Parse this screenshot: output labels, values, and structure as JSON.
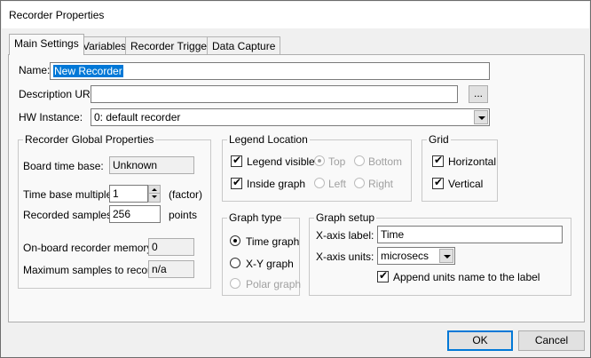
{
  "window": {
    "title": "Recorder Properties"
  },
  "tabs": [
    "Main Settings",
    "Variables",
    "Recorder Trigger",
    "Data Capture"
  ],
  "fields": {
    "name_label": "Name:",
    "name_value": "New Recorder",
    "desc_label": "Description URL:",
    "desc_value": "",
    "browse_label": "...",
    "hw_label": "HW Instance:",
    "hw_value": "0: default recorder"
  },
  "global_props": {
    "title": "Recorder Global Properties",
    "board_time_base_label": "Board time base:",
    "board_time_base_value": "Unknown",
    "time_base_multiple_label": "Time base multiple:",
    "time_base_multiple_value": "1",
    "factor_label": "(factor)",
    "recorded_samples_label": "Recorded samples:",
    "recorded_samples_value": "256",
    "points_label": "points",
    "onboard_memory_label": "On-board recorder memory:",
    "onboard_memory_value": "0",
    "max_samples_label": "Maximum samples to record:",
    "max_samples_value": "n/a"
  },
  "legend": {
    "title": "Legend Location",
    "visible_label": "Legend visible",
    "visible_checked": true,
    "inside_label": "Inside graph",
    "inside_checked": true,
    "top_label": "Top",
    "bottom_label": "Bottom",
    "left_label": "Left",
    "right_label": "Right"
  },
  "grid": {
    "title": "Grid",
    "horizontal_label": "Horizontal",
    "vertical_label": "Vertical"
  },
  "graph_type": {
    "title": "Graph type",
    "time_label": "Time graph",
    "xy_label": "X-Y graph",
    "polar_label": "Polar graph",
    "selected": "Time graph"
  },
  "graph_setup": {
    "title": "Graph setup",
    "xaxis_label_label": "X-axis label:",
    "xaxis_label_value": "Time",
    "xaxis_units_label": "X-axis units:",
    "xaxis_units_value": "microsecs",
    "append_label": "Append units name to the label"
  },
  "buttons": {
    "ok": "OK",
    "cancel": "Cancel"
  }
}
